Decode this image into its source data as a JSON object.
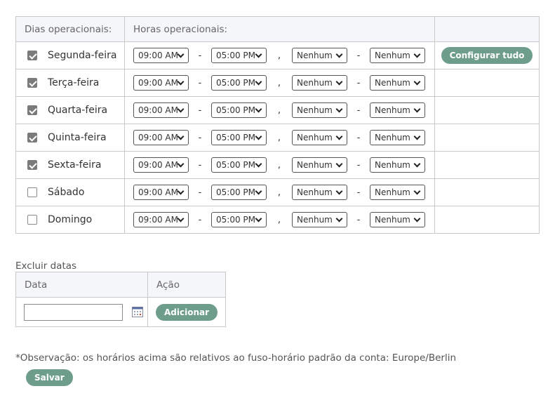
{
  "schedule": {
    "header_days": "Dias operacionais:",
    "header_hours": "Horas operacionais:",
    "configure_all_label": "Configurar tudo",
    "separator_dash": "-",
    "separator_comma": ",",
    "days": [
      {
        "label": "Segunda-feira",
        "checked": true,
        "start": "09:00 AM",
        "end": "05:00 PM",
        "break_start": "Nenhum",
        "break_end": "Nenhum"
      },
      {
        "label": "Terça-feira",
        "checked": true,
        "start": "09:00 AM",
        "end": "05:00 PM",
        "break_start": "Nenhum",
        "break_end": "Nenhum"
      },
      {
        "label": "Quarta-feira",
        "checked": true,
        "start": "09:00 AM",
        "end": "05:00 PM",
        "break_start": "Nenhum",
        "break_end": "Nenhum"
      },
      {
        "label": "Quinta-feira",
        "checked": true,
        "start": "09:00 AM",
        "end": "05:00 PM",
        "break_start": "Nenhum",
        "break_end": "Nenhum"
      },
      {
        "label": "Sexta-feira",
        "checked": true,
        "start": "09:00 AM",
        "end": "05:00 PM",
        "break_start": "Nenhum",
        "break_end": "Nenhum"
      },
      {
        "label": "Sábado",
        "checked": false,
        "start": "09:00 AM",
        "end": "05:00 PM",
        "break_start": "Nenhum",
        "break_end": "Nenhum"
      },
      {
        "label": "Domingo",
        "checked": false,
        "start": "09:00 AM",
        "end": "05:00 PM",
        "break_start": "Nenhum",
        "break_end": "Nenhum"
      }
    ]
  },
  "exclude": {
    "title": "Excluir datas",
    "header_date": "Data",
    "header_action": "Ação",
    "date_value": "",
    "add_label": "Adicionar"
  },
  "note": "*Observação: os horários acima são relativos ao fuso-horário padrão da conta: Europe/Berlin",
  "save_label": "Salvar",
  "colors": {
    "button": "#6e9e8b",
    "header_bg": "#f5f6fa",
    "border": "#c9c9c9",
    "checkbox_checked": "#7b7b7b"
  },
  "icons": [
    "checkbox-icon",
    "chevron-down-icon",
    "calendar-icon"
  ]
}
